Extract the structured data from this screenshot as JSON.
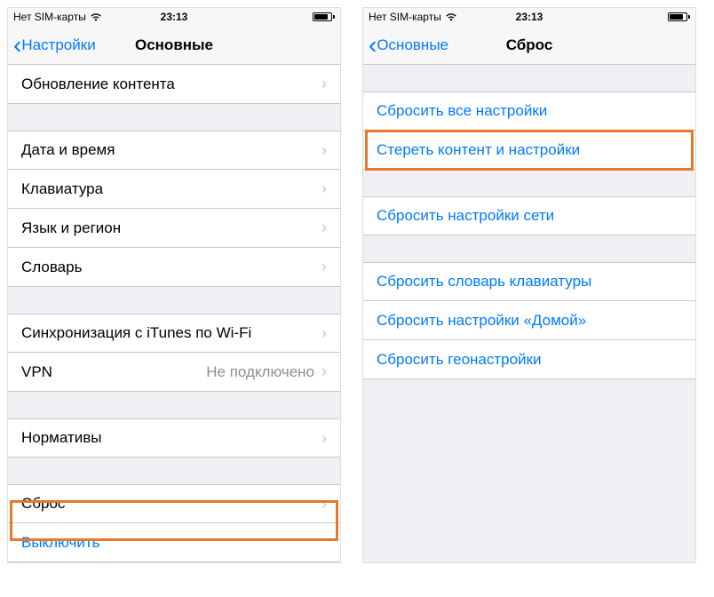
{
  "status": {
    "carrier": "Нет SIM-карты",
    "time": "23:13"
  },
  "left": {
    "back": "Настройки",
    "title": "Основные",
    "groups": [
      [
        {
          "label": "Обновление контента",
          "chevron": true
        }
      ],
      [
        {
          "label": "Дата и время",
          "chevron": true
        },
        {
          "label": "Клавиатура",
          "chevron": true
        },
        {
          "label": "Язык и регион",
          "chevron": true
        },
        {
          "label": "Словарь",
          "chevron": true
        }
      ],
      [
        {
          "label": "Синхронизация с iTunes по Wi-Fi",
          "chevron": true
        },
        {
          "label": "VPN",
          "value": "Не подключено",
          "chevron": true
        }
      ],
      [
        {
          "label": "Нормативы",
          "chevron": true
        }
      ],
      [
        {
          "label": "Сброс",
          "chevron": true
        },
        {
          "label": "Выключить",
          "link": true
        }
      ]
    ]
  },
  "right": {
    "back": "Основные",
    "title": "Сброс",
    "groups": [
      [
        {
          "label": "Сбросить все настройки",
          "link": true
        },
        {
          "label": "Стереть контент и настройки",
          "link": true
        }
      ],
      [
        {
          "label": "Сбросить настройки сети",
          "link": true
        }
      ],
      [
        {
          "label": "Сбросить словарь клавиатуры",
          "link": true
        },
        {
          "label": "Сбросить настройки «Домой»",
          "link": true
        },
        {
          "label": "Сбросить геонастройки",
          "link": true
        }
      ]
    ]
  }
}
